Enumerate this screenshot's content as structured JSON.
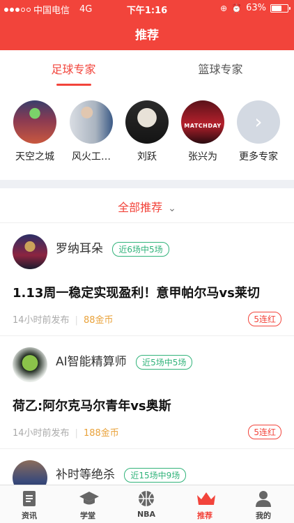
{
  "status": {
    "carrier": "中国电信",
    "network": "4G",
    "time": "下午1:16",
    "battery": "63%",
    "battery_level": 0.63
  },
  "nav": {
    "title": "推荐"
  },
  "tabs": [
    {
      "label": "足球专家",
      "active": true
    },
    {
      "label": "篮球专家",
      "active": false
    }
  ],
  "experts": [
    {
      "name": "天空之城"
    },
    {
      "name": "风火工…"
    },
    {
      "name": "刘跃"
    },
    {
      "name": "张兴为"
    },
    {
      "name": "更多专家"
    }
  ],
  "filter": {
    "label": "全部推荐"
  },
  "cards": [
    {
      "author": "罗纳耳朵",
      "badge": "近6场中5场",
      "title": "1.13周一稳定实现盈利！意甲帕尔马vs莱切",
      "time": "14小时前发布",
      "coins": "88金币",
      "streak": "5连红"
    },
    {
      "author": "AI智能精算师",
      "badge": "近5场中5场",
      "title": "荷乙:阿尔克马尔青年vs奥斯",
      "time": "14小时前发布",
      "coins": "188金币",
      "streak": "5连红"
    },
    {
      "author": "补时等绝杀",
      "badge": "近15场中9场"
    }
  ],
  "tabbar": [
    {
      "label": "资讯",
      "icon": "document-icon",
      "active": false
    },
    {
      "label": "学堂",
      "icon": "graduation-cap-icon",
      "active": false
    },
    {
      "label": "NBA",
      "icon": "basketball-icon",
      "active": false
    },
    {
      "label": "推荐",
      "icon": "crown-icon",
      "active": true
    },
    {
      "label": "我的",
      "icon": "person-icon",
      "active": false
    }
  ],
  "colors": {
    "accent": "#f2443b",
    "badge_green": "#31b37a",
    "coin": "#e9a23b"
  }
}
